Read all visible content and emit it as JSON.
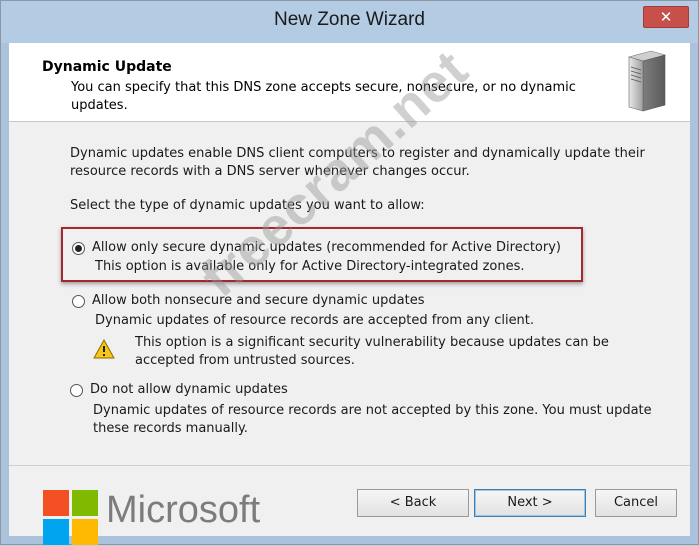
{
  "window": {
    "title": "New Zone Wizard",
    "close_glyph": "✕"
  },
  "header": {
    "title": "Dynamic Update",
    "description": "You can specify that this DNS zone accepts secure, nonsecure, or no dynamic updates.",
    "icon": "server-icon"
  },
  "body": {
    "intro_line1": "Dynamic updates enable DNS client computers to register and dynamically update their",
    "intro_line2": "resource records with a DNS server whenever changes occur.",
    "select_prompt": "Select the type of dynamic updates you want to allow:"
  },
  "options": [
    {
      "label": "Allow only secure dynamic updates (recommended for Active Directory)",
      "description": "This option is available only for Active Directory-integrated zones.",
      "selected": true
    },
    {
      "label": "Allow both nonsecure and secure dynamic updates",
      "description": "Dynamic updates of resource records are accepted from any client.",
      "warning_line1": "This option is a significant security vulnerability because updates can be",
      "warning_line2": "accepted from untrusted sources.",
      "selected": false
    },
    {
      "label": "Do not allow dynamic updates",
      "description_line1": "Dynamic updates of resource records are not accepted by this zone. You must update",
      "description_line2": "these records manually.",
      "selected": false
    }
  ],
  "buttons": {
    "back": "< Back",
    "next": "Next >",
    "cancel": "Cancel"
  },
  "watermark": "freecram.net",
  "branding": {
    "text": "Microsoft",
    "colors": [
      "#f25022",
      "#7fba00",
      "#00a4ef",
      "#ffb900"
    ]
  },
  "colors": {
    "highlight_border": "#a0282e",
    "titlebar": "#b3cbe3",
    "close_button": "#c7504a"
  }
}
